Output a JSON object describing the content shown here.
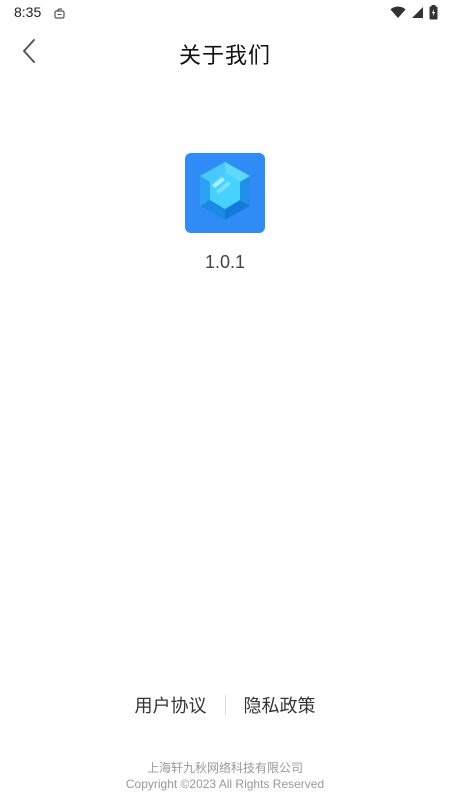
{
  "status_bar": {
    "time": "8:35",
    "icons": [
      "notification-icon",
      "wifi-icon",
      "cell-signal-icon",
      "battery-charging-icon"
    ]
  },
  "header": {
    "title": "关于我们",
    "back_icon": "chevron-left-icon"
  },
  "app_info": {
    "logo_icon": "hexagon-gem-icon",
    "version": "1.0.1"
  },
  "footer": {
    "links": [
      "用户协议",
      "隐私政策"
    ],
    "company": "上海轩九秋网络科技有限公司",
    "copyright": "Copyright ©2023 All Rights Reserved"
  },
  "colors": {
    "logo_background": "#2f8cf7",
    "logo_gem": "#4fd6ff",
    "text_primary": "#111111",
    "text_secondary": "#999999"
  }
}
